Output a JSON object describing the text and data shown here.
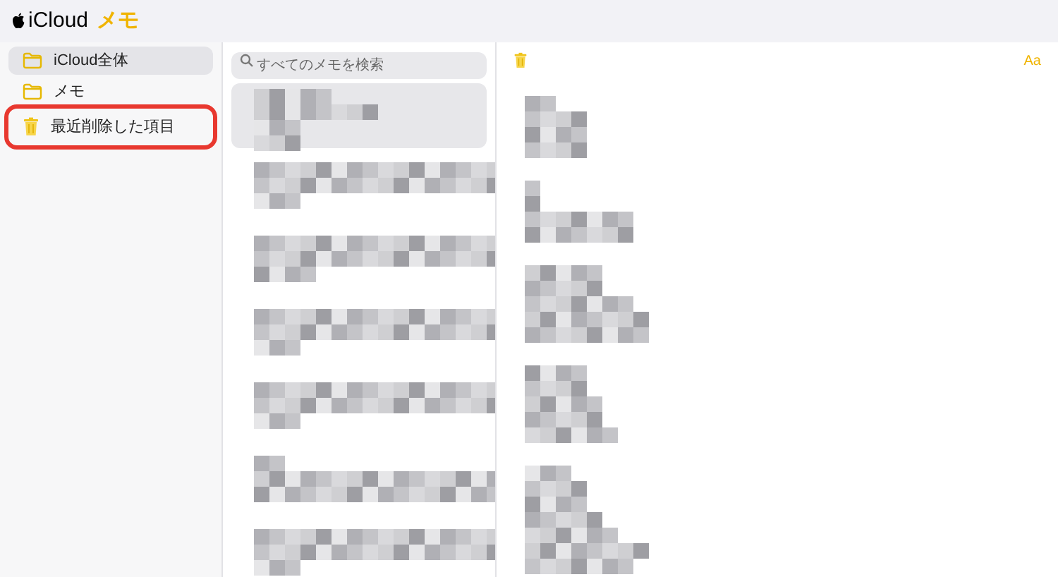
{
  "header": {
    "logo_text": "iCloud",
    "app_name": "メモ"
  },
  "sidebar": {
    "items": [
      {
        "label": "iCloud全体",
        "kind": "folder",
        "selected": true,
        "marked": false
      },
      {
        "label": "メモ",
        "kind": "folder",
        "selected": false,
        "marked": false
      },
      {
        "label": "最近削除した項目",
        "kind": "trash",
        "selected": false,
        "marked": true
      }
    ]
  },
  "search": {
    "placeholder": "すべてのメモを検索"
  },
  "notes": [
    {
      "selected": true
    },
    {
      "selected": false
    },
    {
      "selected": false
    },
    {
      "selected": false
    },
    {
      "selected": false
    },
    {
      "selected": false
    },
    {
      "selected": false
    }
  ],
  "editor": {
    "format_button": "Aa"
  }
}
